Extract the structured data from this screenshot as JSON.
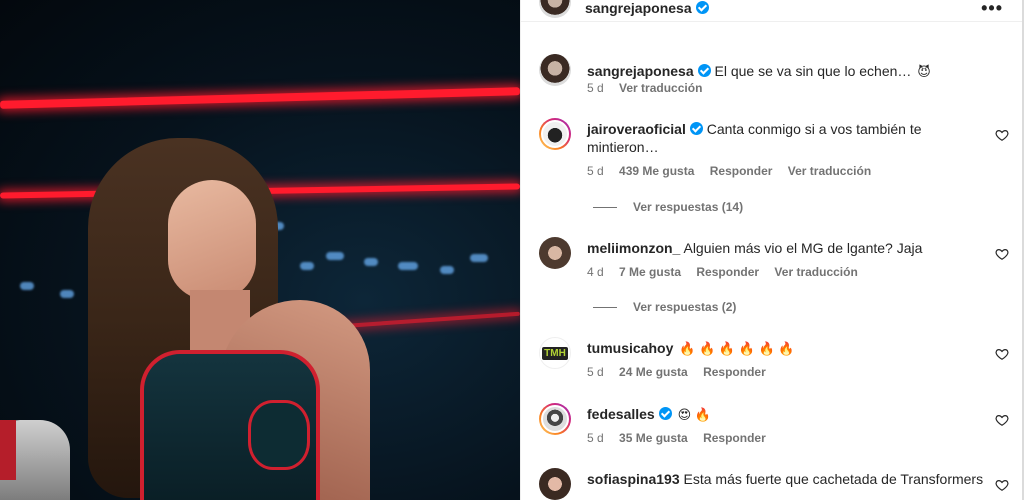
{
  "header": {
    "username": "sangrejaponesa",
    "more_label": "•••"
  },
  "caption": {
    "username": "sangrejaponesa",
    "text": "El que se va sin que lo echen…",
    "emoji": "😈",
    "time": "5 d",
    "translate": "Ver traducción"
  },
  "comments": [
    {
      "username": "jairoveraoficial",
      "text": "Canta conmigo si a vos también te mintieron…",
      "time": "5 d",
      "likes": "439 Me gusta",
      "reply": "Responder",
      "translate": "Ver traducción",
      "view_replies": "Ver respuestas (14)"
    },
    {
      "username": "meliimonzon_",
      "text": "Alguien más vio el MG de lgante? Jaja",
      "time": "4 d",
      "likes": "7 Me gusta",
      "reply": "Responder",
      "translate": "Ver traducción",
      "view_replies": "Ver respuestas (2)"
    },
    {
      "username": "tumusicahoy",
      "emoji": "🔥 🔥 🔥 🔥 🔥 🔥",
      "time": "5 d",
      "likes": "24 Me gusta",
      "reply": "Responder",
      "avatar_text": "TMH"
    },
    {
      "username": "fedesalles",
      "emoji": "😍 🔥",
      "time": "5 d",
      "likes": "35 Me gusta",
      "reply": "Responder"
    },
    {
      "username": "sofiaspina193",
      "text": "Esta más fuerte que cachetada de Transformers"
    }
  ],
  "icons": {
    "verified": "verified-badge-icon",
    "heart": "heart-outline-icon",
    "more": "more-horizontal-icon"
  },
  "colors": {
    "verified": "#0095f6",
    "muted": "#737373",
    "text": "#262626",
    "neon": "#ff1b2d"
  }
}
